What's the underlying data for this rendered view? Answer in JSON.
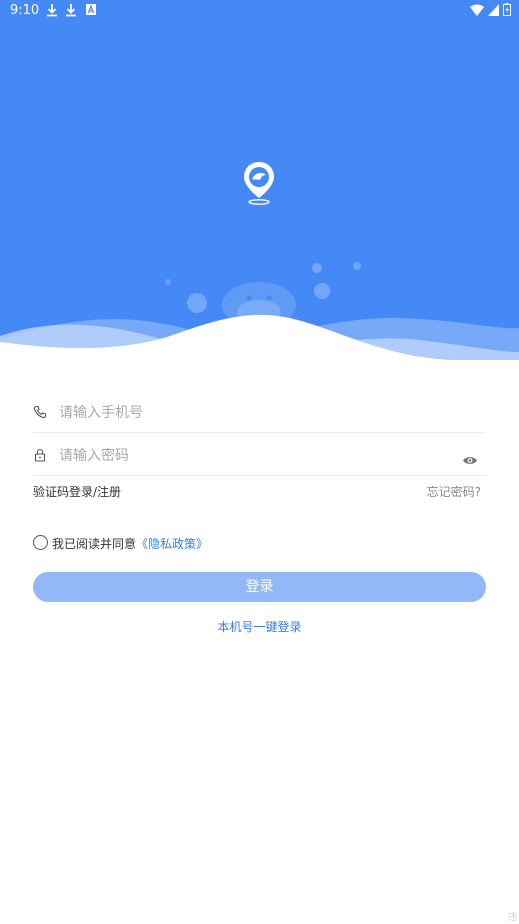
{
  "status_bar": {
    "time": "9:10",
    "icons": [
      "download-icon",
      "download-icon",
      "a-icon",
      "wifi-icon",
      "signal-icon",
      "battery-icon"
    ]
  },
  "colors": {
    "brand_blue": "#4589f6",
    "button_disabled": "#93b8f7",
    "link_blue": "#3b7de8"
  },
  "login": {
    "phone_placeholder": "请输入手机号",
    "password_placeholder": "请输入密码",
    "sms_login_label": "验证码登录/注册",
    "forgot_password_label": "忘记密码?",
    "agree_prefix": "我已阅读并同意",
    "privacy_policy_label": "《隐私政策》",
    "submit_label": "登录",
    "one_key_login_label": "本机号一键登录"
  },
  "corner_mark": "违"
}
